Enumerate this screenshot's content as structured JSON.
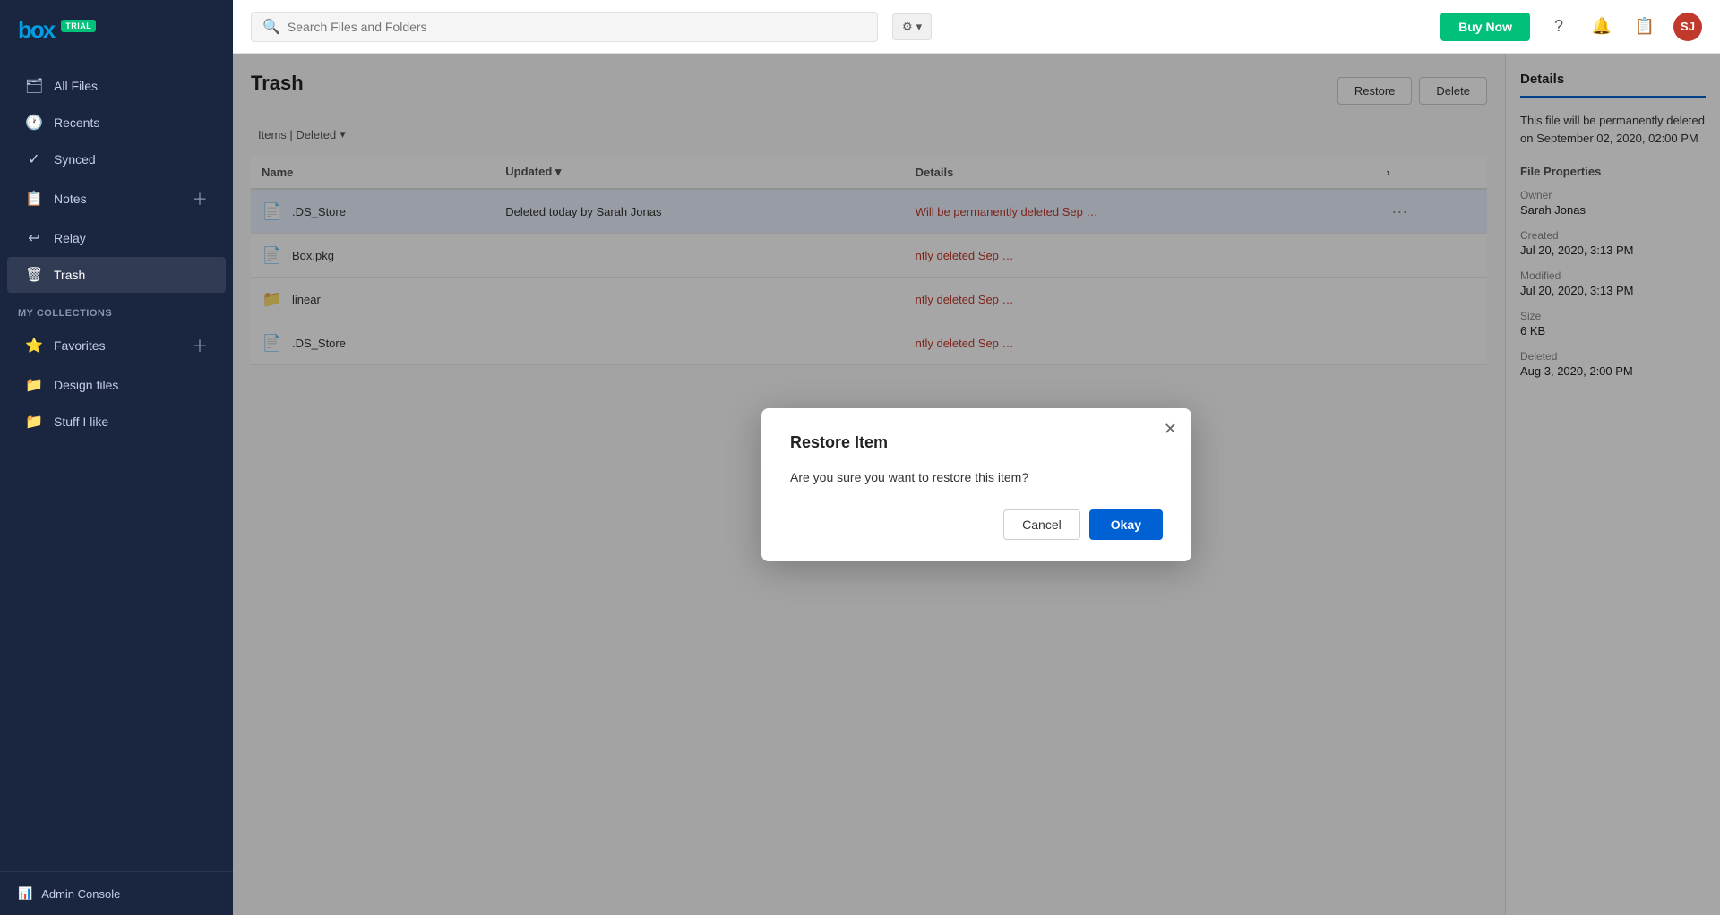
{
  "sidebar": {
    "logo": "box",
    "trial_badge": "TRIAL",
    "nav_items": [
      {
        "id": "all-files",
        "label": "All Files",
        "icon": "🗂",
        "active": false
      },
      {
        "id": "recents",
        "label": "Recents",
        "icon": "🕐",
        "active": false
      },
      {
        "id": "synced",
        "label": "Synced",
        "icon": "✓",
        "active": false
      },
      {
        "id": "notes",
        "label": "Notes",
        "icon": "📋",
        "active": false,
        "has_plus": true
      },
      {
        "id": "relay",
        "label": "Relay",
        "icon": "↩",
        "active": false
      },
      {
        "id": "trash",
        "label": "Trash",
        "icon": "🗑",
        "active": true
      }
    ],
    "collections_section": "My Collections",
    "collection_items": [
      {
        "id": "favorites",
        "label": "Favorites",
        "icon": "⭐",
        "has_plus": true
      },
      {
        "id": "design-files",
        "label": "Design files",
        "icon": "📁"
      },
      {
        "id": "stuff-i-like",
        "label": "Stuff I like",
        "icon": "📁"
      }
    ],
    "footer_item": {
      "label": "Admin Console",
      "icon": "📊"
    }
  },
  "header": {
    "search_placeholder": "Search Files and Folders",
    "buy_now_label": "Buy Now",
    "avatar_initials": "SJ"
  },
  "main": {
    "page_title": "Trash",
    "breadcrumb_label": "Items | Deleted",
    "restore_button": "Restore",
    "delete_button": "Delete",
    "table": {
      "col_name": "Name",
      "col_updated": "Updated",
      "col_details": "Details",
      "rows": [
        {
          "name": ".DS_Store",
          "updated": "Deleted today by Sarah Jonas",
          "details": "Will be permanently deleted Sep …",
          "icon_type": "doc",
          "selected": true
        },
        {
          "name": "Box.pkg",
          "updated": "",
          "details": "ntly deleted Sep …",
          "icon_type": "doc",
          "selected": false
        },
        {
          "name": "linear",
          "updated": "",
          "details": "ntly deleted Sep …",
          "icon_type": "folder",
          "selected": false
        },
        {
          "name": ".DS_Store",
          "updated": "",
          "details": "ntly deleted Sep …",
          "icon_type": "doc",
          "selected": false
        }
      ]
    }
  },
  "right_panel": {
    "title": "Details",
    "description": "This file will be permanently deleted on September 02, 2020, 02:00 PM",
    "file_properties_label": "File Properties",
    "owner_label": "Owner",
    "owner_value": "Sarah Jonas",
    "created_label": "Created",
    "created_value": "Jul 20, 2020, 3:13 PM",
    "modified_label": "Modified",
    "modified_value": "Jul 20, 2020, 3:13 PM",
    "size_label": "Size",
    "size_value": "6 KB",
    "deleted_label": "Deleted",
    "deleted_value": "Aug 3, 2020, 2:00 PM"
  },
  "modal": {
    "title": "Restore Item",
    "body": "Are you sure you want to restore this item?",
    "cancel_label": "Cancel",
    "okay_label": "Okay"
  }
}
